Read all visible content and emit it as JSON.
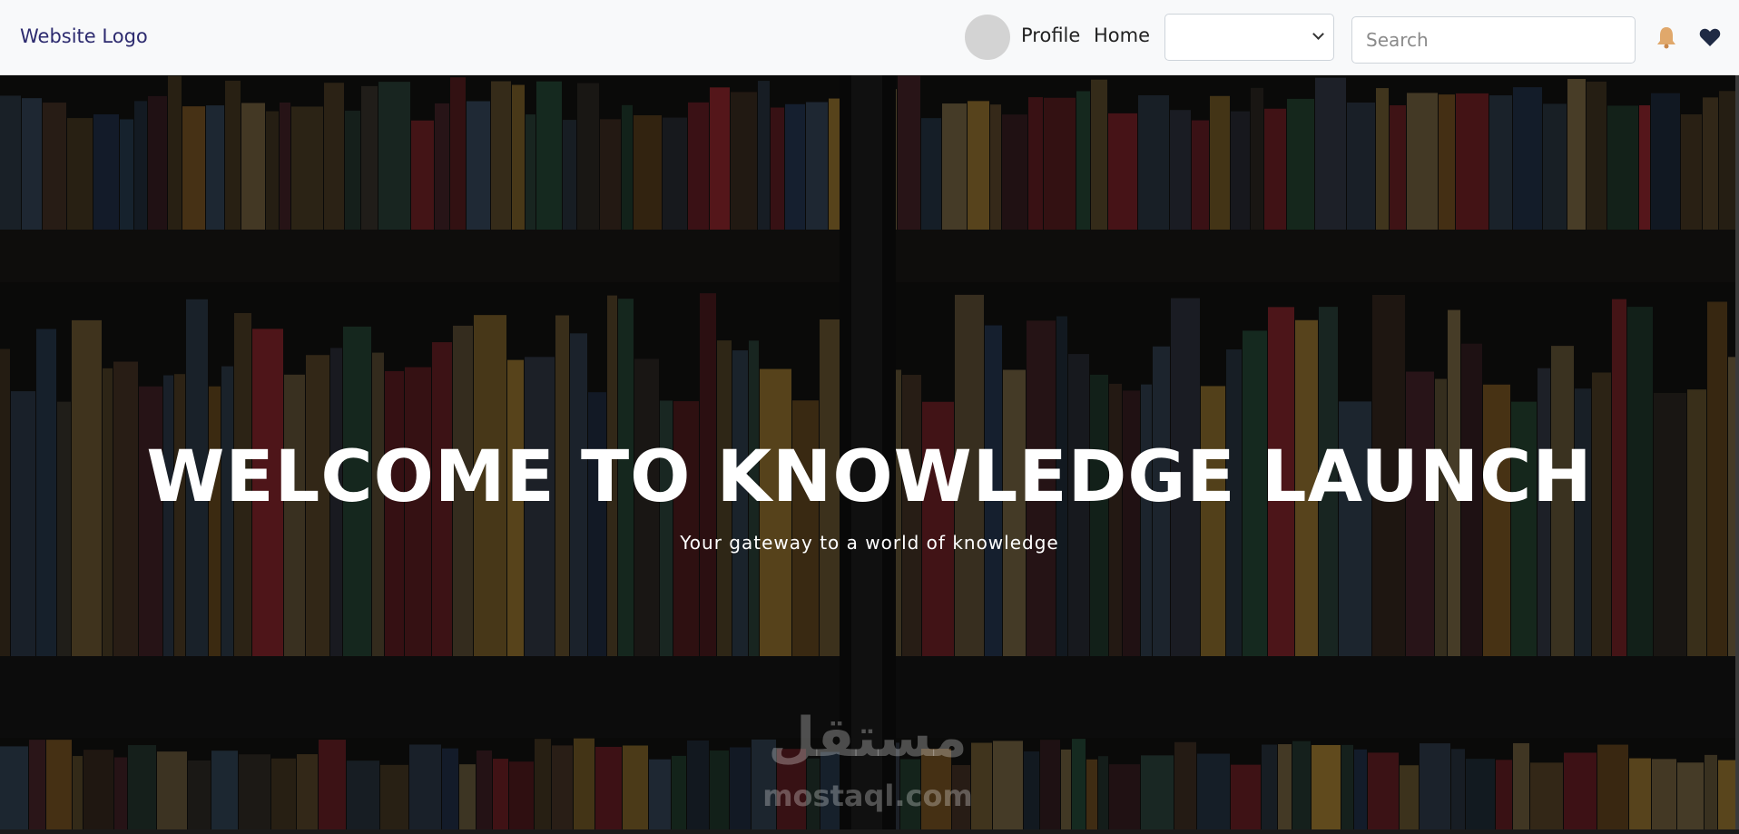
{
  "navbar": {
    "logo": "Website Logo",
    "profile_link": "Profile",
    "home_link": "Home",
    "select_value": "",
    "search_placeholder": "Search",
    "icons": [
      "bell-icon",
      "heart-icon"
    ]
  },
  "hero": {
    "title": "WELCOME TO KNOWLEDGE LAUNCH",
    "subtitle": "Your gateway to a world of knowledge"
  },
  "watermark": {
    "arabic": "مستقل",
    "latin": "mostaql.com"
  },
  "colors": {
    "navbar_bg": "#f8f9fa",
    "logo_text": "#2d2b6f",
    "hero_text": "#ffffff",
    "bell": "#e0a86b",
    "heart": "#1f2a44"
  }
}
